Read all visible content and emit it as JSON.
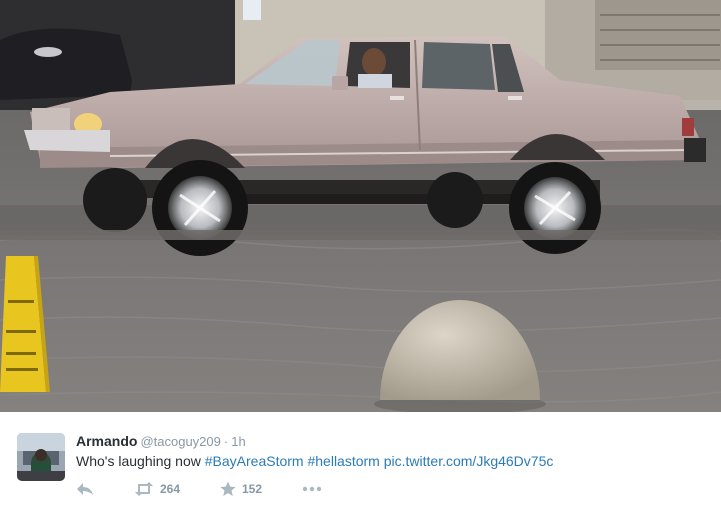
{
  "photo": {
    "alt_icon": "flooded-street-photo"
  },
  "tweet": {
    "display_name": "Armando",
    "screen_name": "@tacoguy209",
    "separator": "·",
    "time": "1h",
    "text_plain": "Who's laughing now ",
    "hashtag_1": "#BayAreaStorm",
    "hashtag_2": "#hellastorm",
    "media_link": "pic.twitter.com/Jkg46Dv75c",
    "retweet_count": "264",
    "favorite_count": "152"
  },
  "icons": {
    "reply": "reply-icon",
    "retweet": "retweet-icon",
    "favorite": "star-icon",
    "more": "more-dots-icon"
  },
  "colors": {
    "link": "#2b7bb9",
    "muted": "#8899a6",
    "text": "#292f33",
    "icon": "#aab8c2"
  }
}
